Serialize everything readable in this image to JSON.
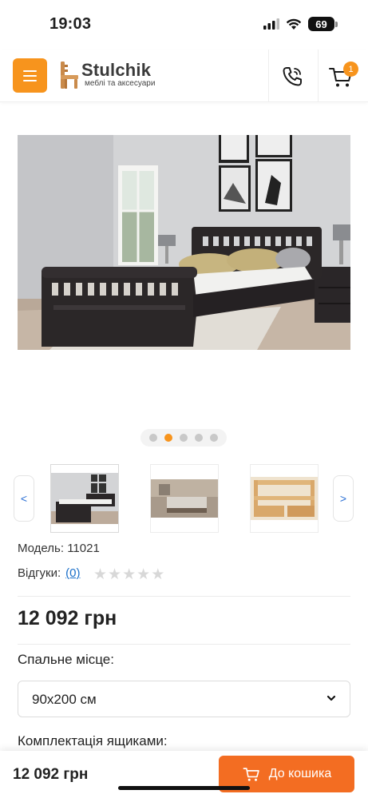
{
  "status": {
    "time": "19:03",
    "battery": "69"
  },
  "header": {
    "logo_title": "Stulchik",
    "logo_subtitle": "меблі та аксесуари",
    "cart_count": "1"
  },
  "gallery": {
    "slides": 5,
    "active_slide": 2,
    "prev_label": "<",
    "next_label": ">"
  },
  "product": {
    "model_label": "Модель:",
    "model_value": "11021",
    "reviews_label": "Відгуки:",
    "reviews_count": "(0)",
    "rating": 0,
    "price": "12 092 грн",
    "sleep_label": "Спальне місце:",
    "sleep_value": "90х200 см",
    "drawers_label": "Комплектація ящиками:"
  },
  "bottom": {
    "price": "12 092 грн",
    "buy_label": "До кошика"
  },
  "colors": {
    "accent": "#f7941d",
    "buy": "#f36d22",
    "link": "#1a6fc9"
  }
}
